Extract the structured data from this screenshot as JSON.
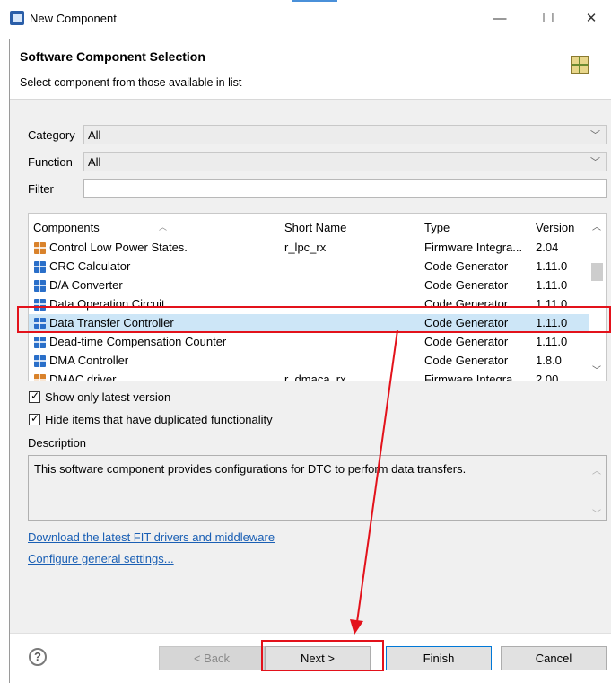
{
  "window": {
    "title": "New Component",
    "minimize": "—",
    "maximize": "☐",
    "close": "✕"
  },
  "header": {
    "title": "Software Component Selection",
    "subtitle": "Select component from those available in list"
  },
  "form": {
    "category_label": "Category",
    "category_value": "All",
    "function_label": "Function",
    "function_value": "All",
    "filter_label": "Filter",
    "filter_value": ""
  },
  "table": {
    "columns": [
      "Components",
      "Short Name",
      "Type",
      "Version"
    ],
    "rows": [
      {
        "name": "Control Low Power States.",
        "short": "r_lpc_rx",
        "type": "Firmware Integra...",
        "version": "2.04",
        "icon": "orange"
      },
      {
        "name": "CRC Calculator",
        "short": "",
        "type": "Code Generator",
        "version": "1.11.0",
        "icon": "blue"
      },
      {
        "name": "D/A Converter",
        "short": "",
        "type": "Code Generator",
        "version": "1.11.0",
        "icon": "blue"
      },
      {
        "name": "Data Operation Circuit",
        "short": "",
        "type": "Code Generator",
        "version": "1.11.0",
        "icon": "blue"
      },
      {
        "name": "Data Transfer Controller",
        "short": "",
        "type": "Code Generator",
        "version": "1.11.0",
        "icon": "blue"
      },
      {
        "name": "Dead-time Compensation Counter",
        "short": "",
        "type": "Code Generator",
        "version": "1.11.0",
        "icon": "blue"
      },
      {
        "name": "DMA Controller",
        "short": "",
        "type": "Code Generator",
        "version": "1.8.0",
        "icon": "blue"
      },
      {
        "name": "DMAC driver",
        "short": "r_dmaca_rx",
        "type": "Firmware Integra...",
        "version": "2.00",
        "icon": "orange"
      }
    ],
    "selected_index": 4
  },
  "options": {
    "latest_label": "Show only latest version",
    "latest_checked": true,
    "dup_label": "Hide items that have duplicated functionality",
    "dup_checked": true
  },
  "description": {
    "label": "Description",
    "text": "This software component provides configurations for DTC to perform data transfers."
  },
  "links": {
    "download": "Download the latest FIT drivers and middleware",
    "configure": "Configure general settings..."
  },
  "buttons": {
    "back": "< Back",
    "next": "Next >",
    "finish": "Finish",
    "cancel": "Cancel",
    "help": "?"
  },
  "colors": {
    "highlight": "#e3121b",
    "selection": "#cde6f7",
    "link": "#1a5fb4"
  }
}
